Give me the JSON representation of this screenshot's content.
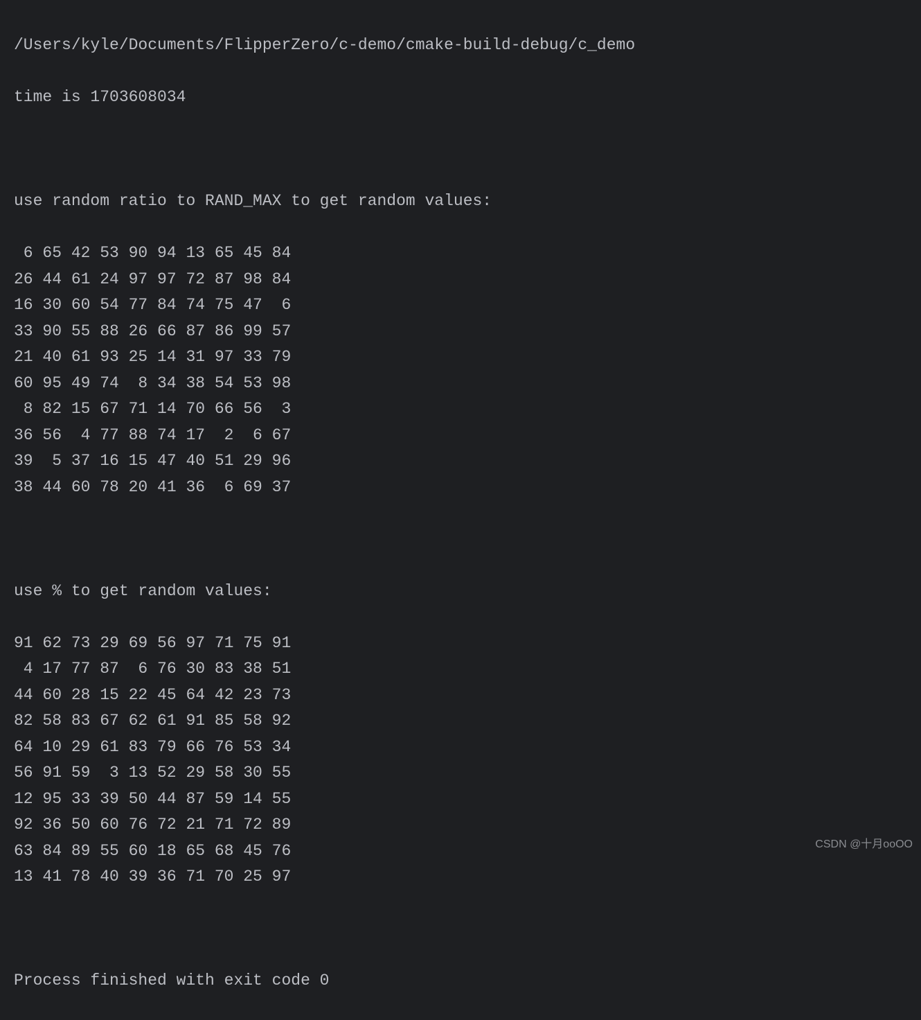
{
  "terminal": {
    "path": "/Users/kyle/Documents/FlipperZero/c-demo/cmake-build-debug/c_demo",
    "time_prefix": "time is ",
    "time_value": "1703608034",
    "section1_header": "use random ratio to RAND_MAX to get random values:",
    "section1_rows": [
      [
        6,
        65,
        42,
        53,
        90,
        94,
        13,
        65,
        45,
        84
      ],
      [
        26,
        44,
        61,
        24,
        97,
        97,
        72,
        87,
        98,
        84
      ],
      [
        16,
        30,
        60,
        54,
        77,
        84,
        74,
        75,
        47,
        6
      ],
      [
        33,
        90,
        55,
        88,
        26,
        66,
        87,
        86,
        99,
        57
      ],
      [
        21,
        40,
        61,
        93,
        25,
        14,
        31,
        97,
        33,
        79
      ],
      [
        60,
        95,
        49,
        74,
        8,
        34,
        38,
        54,
        53,
        98
      ],
      [
        8,
        82,
        15,
        67,
        71,
        14,
        70,
        66,
        56,
        3
      ],
      [
        36,
        56,
        4,
        77,
        88,
        74,
        17,
        2,
        6,
        67
      ],
      [
        39,
        5,
        37,
        16,
        15,
        47,
        40,
        51,
        29,
        96
      ],
      [
        38,
        44,
        60,
        78,
        20,
        41,
        36,
        6,
        69,
        37
      ]
    ],
    "section2_header": "use % to get random values:",
    "section2_rows": [
      [
        91,
        62,
        73,
        29,
        69,
        56,
        97,
        71,
        75,
        91
      ],
      [
        4,
        17,
        77,
        87,
        6,
        76,
        30,
        83,
        38,
        51
      ],
      [
        44,
        60,
        28,
        15,
        22,
        45,
        64,
        42,
        23,
        73
      ],
      [
        82,
        58,
        83,
        67,
        62,
        61,
        91,
        85,
        58,
        92
      ],
      [
        64,
        10,
        29,
        61,
        83,
        79,
        66,
        76,
        53,
        34
      ],
      [
        56,
        91,
        59,
        3,
        13,
        52,
        29,
        58,
        30,
        55
      ],
      [
        12,
        95,
        33,
        39,
        50,
        44,
        87,
        59,
        14,
        55
      ],
      [
        92,
        36,
        50,
        60,
        76,
        72,
        21,
        71,
        72,
        89
      ],
      [
        63,
        84,
        89,
        55,
        60,
        18,
        65,
        68,
        45,
        76
      ],
      [
        13,
        41,
        78,
        40,
        39,
        36,
        71,
        70,
        25,
        97
      ]
    ],
    "exit_message": "Process finished with exit code 0"
  },
  "watermark": "CSDN @十月ooOO"
}
